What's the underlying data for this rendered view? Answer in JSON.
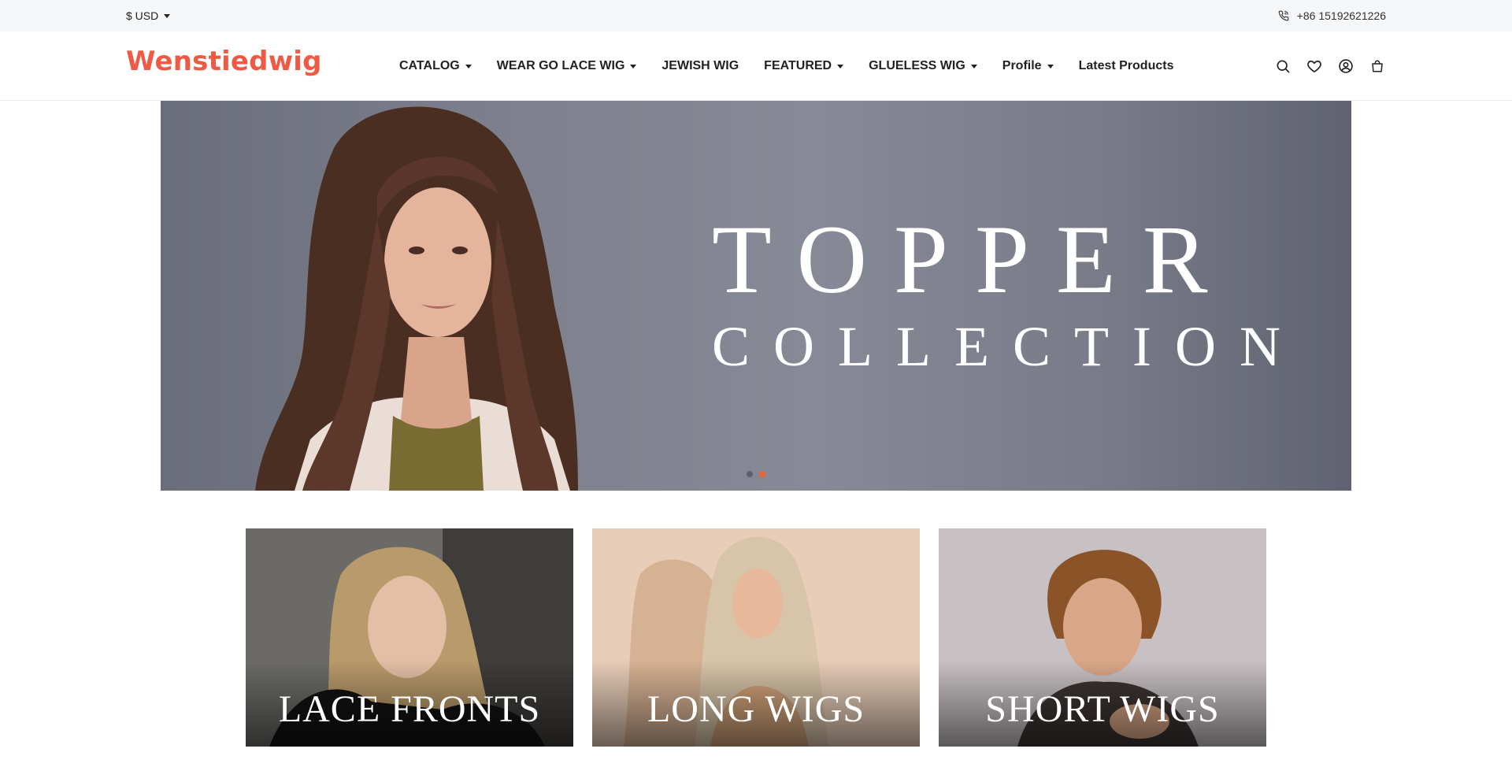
{
  "topbar": {
    "currency_label": "$ USD",
    "phone": "+86 15192621226"
  },
  "header": {
    "logo": "Wenstiedwig",
    "nav": [
      {
        "label": "CATALOG",
        "has_dropdown": true
      },
      {
        "label": "WEAR GO LACE WIG",
        "has_dropdown": true
      },
      {
        "label": "JEWISH WIG",
        "has_dropdown": false
      },
      {
        "label": "FEATURED",
        "has_dropdown": true
      },
      {
        "label": "GLUELESS WIG",
        "has_dropdown": true
      },
      {
        "label": "Profile",
        "has_dropdown": true
      },
      {
        "label": "Latest Products",
        "has_dropdown": false
      }
    ],
    "icons": [
      "search-icon",
      "heart-icon",
      "user-icon",
      "cart-icon"
    ]
  },
  "hero": {
    "title": "TOPPER",
    "subtitle": "COLLECTION",
    "slide_count": 2,
    "active_slide": 2,
    "colors": {
      "background": "#7e818d",
      "active_dot": "#e8662e"
    }
  },
  "categories": [
    {
      "label": "LACE FRONTS"
    },
    {
      "label": "LONG WIGS"
    },
    {
      "label": "SHORT WIGS"
    }
  ],
  "colors": {
    "brand": "#ef5a44",
    "topbar_bg": "#f6f7f9"
  }
}
